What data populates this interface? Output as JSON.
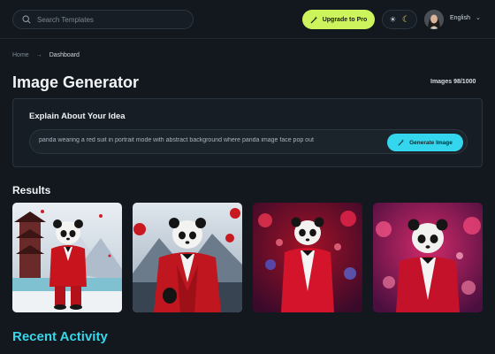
{
  "header": {
    "search_placeholder": "Search Templates",
    "upgrade_label": "Upgrade to Pro",
    "language": "English"
  },
  "breadcrumb": {
    "home": "Home",
    "current": "Dashboard"
  },
  "page": {
    "title": "Image Generator",
    "quota": "Images 98/1000"
  },
  "prompt_card": {
    "label": "Explain About Your Idea",
    "prompt_value": "panda wearing a red suit in portrait mode with abstract background where panda image face pop out",
    "generate_label": "Generate Image"
  },
  "results": {
    "heading": "Results",
    "images": [
      {
        "icon": "panda-red-suit-pagoda-image"
      },
      {
        "icon": "panda-red-suit-mountains-image"
      },
      {
        "icon": "panda-red-suit-bokeh-image"
      },
      {
        "icon": "panda-red-suit-pink-bokeh-image"
      }
    ]
  },
  "recent_activity": {
    "heading": "Recent Activity"
  },
  "colors": {
    "background": "#12181e",
    "upgrade_accent": "#cdf45c",
    "generate_accent": "#34d6ee",
    "recent_heading": "#39d5e8"
  }
}
